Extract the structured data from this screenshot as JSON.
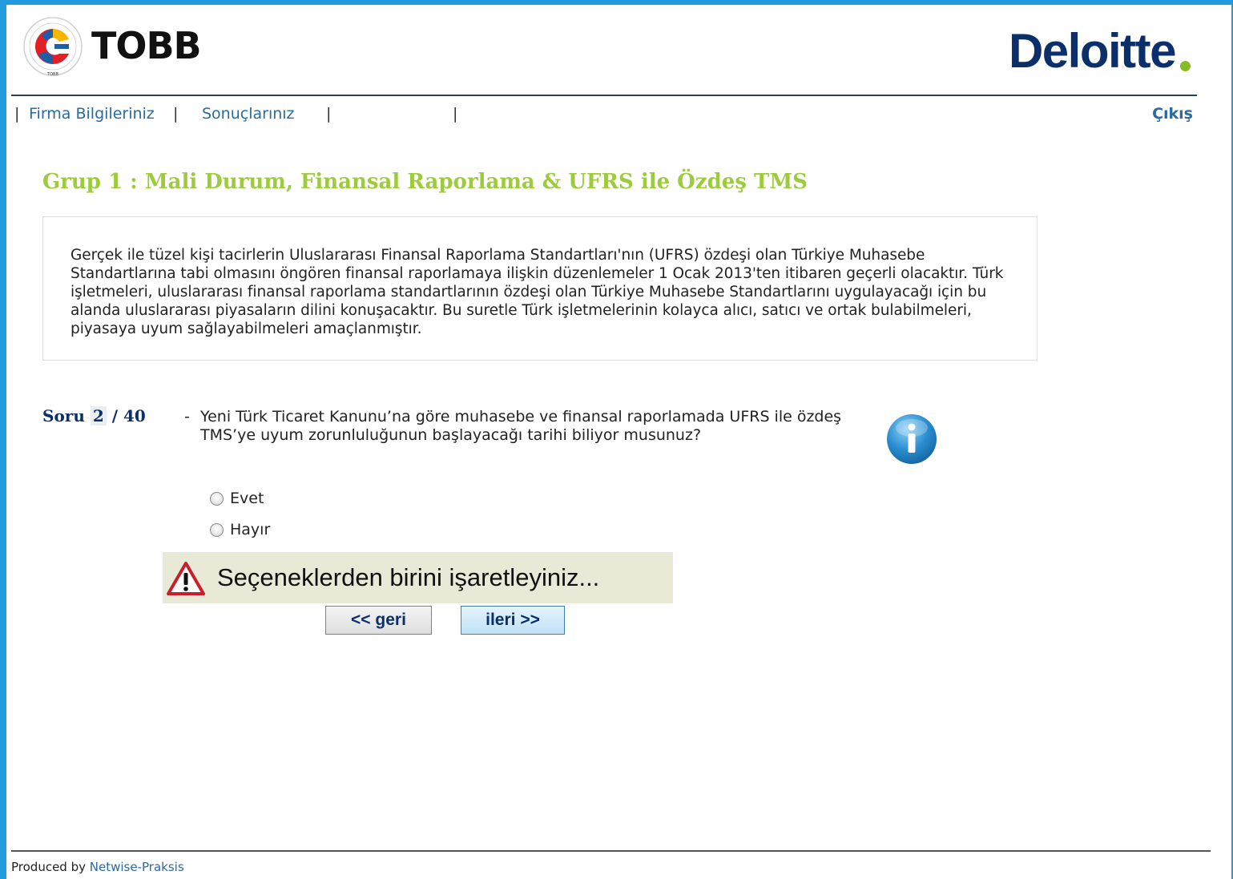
{
  "header": {
    "tobb_label": "TOBB",
    "deloitte_label": "Deloitte",
    "brand_colors": {
      "frame": "#1f9bde",
      "deloitte_blue": "#0b2f6b",
      "deloitte_green": "#86bc25",
      "group_title_green": "#9ccc3c",
      "link_blue": "#2a6a9e"
    }
  },
  "nav": {
    "items": [
      {
        "label": "Firma Bilgileriniz"
      },
      {
        "label": "Sonuçlarınız"
      }
    ],
    "separator": "|",
    "logout_label": "Çıkış"
  },
  "group": {
    "title": "Grup 1 : Mali Durum, Finansal Raporlama & UFRS ile Özdeş TMS",
    "description": "Gerçek ile tüzel kişi tacirlerin Uluslararası Finansal Raporlama Standartları'nın (UFRS) özdeşi olan Türkiye Muhasebe Standartlarına tabi olmasını öngören finansal raporlamaya ilişkin düzenlemeler 1 Ocak 2013'ten itibaren geçerli olacaktır. Türk işletmeleri, uluslararası finansal raporlama standartlarının özdeşi olan Türkiye Muhasebe Standartlarını uygulayacağı için bu alanda uluslararası piyasaların dilini konuşacaktır. Bu suretle Türk işletmelerinin kolayca alıcı, satıcı ve ortak bulabilmeleri, piyasaya uyum sağlayabilmeleri amaçlanmıştır."
  },
  "question": {
    "label": "Soru",
    "current": "2",
    "divider": "/",
    "total": "40",
    "dash": "-",
    "text": "Yeni Türk Ticaret Kanunu’na göre muhasebe ve finansal raporlamada UFRS ile özdeş TMS’ye uyum zorunluluğunun başlayacağı tarihi biliyor musunuz?",
    "info_icon": "info-icon",
    "options": [
      {
        "label": "Evet",
        "selected": false
      },
      {
        "label": "Hayır",
        "selected": false
      }
    ]
  },
  "alert": {
    "icon": "warning-icon",
    "text": "Seçeneklerden birini işaretleyiniz..."
  },
  "buttons": {
    "back_label": "<< geri",
    "next_label": "ileri >>"
  },
  "footer": {
    "prefix": "Produced by",
    "link": "Netwise-Praksis"
  }
}
